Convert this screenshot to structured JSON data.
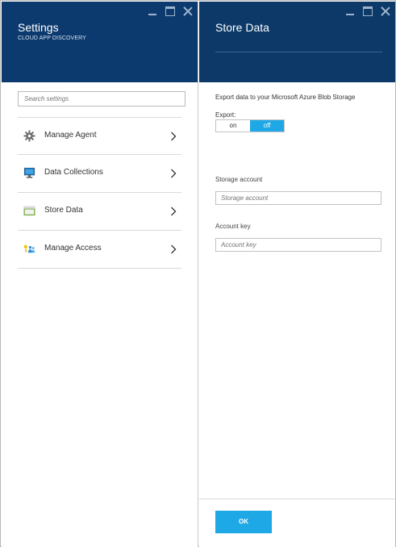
{
  "settings_blade": {
    "title": "Settings",
    "subtitle": "CLOUD APP DISCOVERY",
    "window_controls": [
      "minimize-icon",
      "maximize-icon",
      "close-icon"
    ],
    "search": {
      "placeholder": "Search settings",
      "value": ""
    },
    "items": [
      {
        "label": "Manage Agent",
        "icon": "gear-icon"
      },
      {
        "label": "Data Collections",
        "icon": "monitor-icon"
      },
      {
        "label": "Store Data",
        "icon": "storage-icon"
      },
      {
        "label": "Manage Access",
        "icon": "users-key-icon"
      }
    ]
  },
  "store_blade": {
    "title": "Store Data",
    "window_controls": [
      "minimize-icon",
      "maximize-icon",
      "close-icon"
    ],
    "description": "Export data to your Microsoft Azure Blob Storage",
    "export": {
      "label": "Export:",
      "on_label": "on",
      "off_label": "off",
      "selected": "off"
    },
    "storage_account": {
      "label": "Storage account",
      "placeholder": "Storage account",
      "value": ""
    },
    "account_key": {
      "label": "Account key",
      "placeholder": "Account key",
      "value": ""
    },
    "ok_label": "OK"
  },
  "colors": {
    "header_bg": "#0d3a6e",
    "accent": "#1ea8e6"
  }
}
